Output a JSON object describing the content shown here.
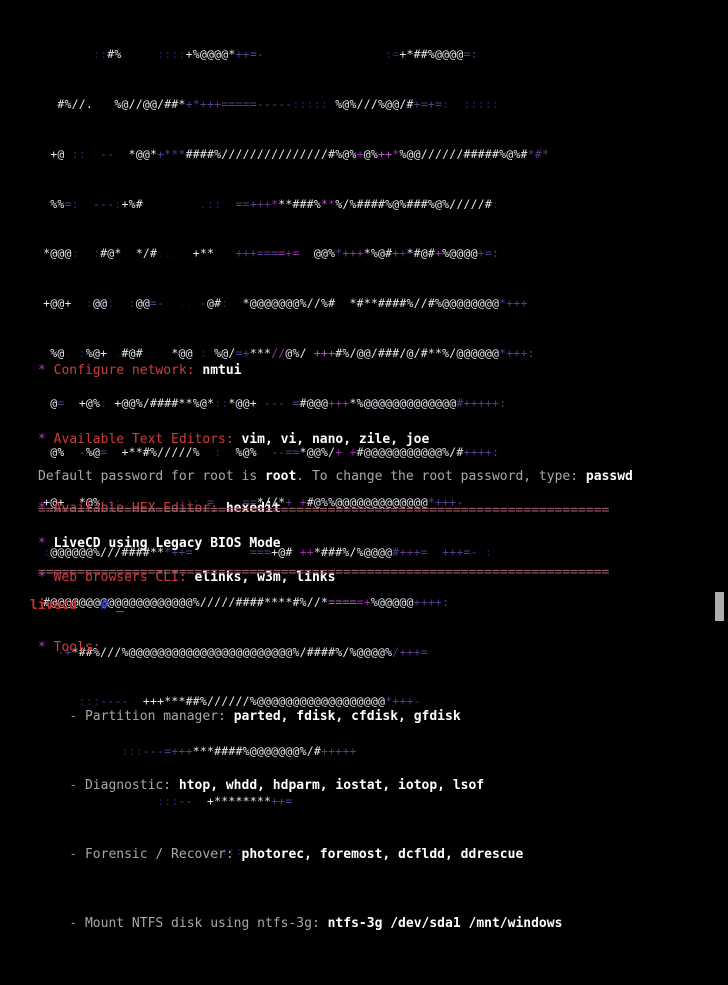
{
  "terminal": {
    "background_color": "#000000",
    "ascii_art": {
      "description": "systemrescue-liveCD ascii logo",
      "rows": [
        "      :#%.    :::+%@@@@*++=-                 :=+*##%@@@@=:",
        "   #%//.   %@//@@/##*++++===----:::::  %@%///%@@/#+=+=:  :::::",
        "  +@ ::  --  *@@*+***####%///////////////#%@%+  @%++*%@@//////#####%##*#*",
        "  %%=:  --:+%#        .::  ==+++#**###@#*#*%%/%#####%@%###%@%/////#:",
        " *@@@:  :#@*  */#.....+**   +++===-=+=  @@%*+++*%@#++*#@#+%@@@@+=:",
        " +@@+  :@@:  :@=-  .. -@#:  *@@@@@@@%//%#  *#**####%//#%@@@@@@@@*+++",
        "  %@. :%@+ .#@#    *@@ : %@/=+***//@%/ +++#%/@@/###/@/#**%/@@@@@@*+++:",
        "  @=  +@%: +@@%/####**%@*::*@@+ --- =#@@@+++*%@@@@@@@@@@@@@#+++++:",
        "  @%  -%@= +**#%/////%  :  %@%  --==*@@%/+ +#@@@@@@@@@@@%/#++++:",
        " +@+  *@%:::       .::: =    ==*//*+ +#@%%@@@@@@@@@@@@@*+++-",
        " :@@@@@@%///####***++=        ===+@# ++*###%/%@@@@#+++=  +++=- :",
        " #@@@@@@@@@@@@@@@@@@@@%/////####****#%//*====+%@@@@@++++:",
        "   -+*##%///%@@@@@@@@@@@@@@@@@@@@@@@%/####%/%@@@@/+++=",
        "      :::----  +++***##%//////%@@@@@@@@@@@@@@@@@@*+++-",
        "            :::---=+++***####%@@@@@@@%/#+++++",
        "                 :::--  +********++="
      ]
    },
    "info_lines": [
      {
        "bullet": "*",
        "label": "Configure network",
        "sep": ": ",
        "value": "nmtui"
      },
      {
        "bullet": "*",
        "label": "Available Text Editors",
        "sep": ": ",
        "value": "vim, vi, nano, zile, joe"
      },
      {
        "bullet": "*",
        "label": "Available HEX Editor",
        "sep": ": ",
        "value": "hexedit"
      },
      {
        "bullet": "*",
        "label": "Web browsers CLI",
        "sep": ": ",
        "value": "elinks, w3m, links"
      },
      {
        "bullet": "*",
        "label": "Tools",
        "sep": ":",
        "value": ""
      }
    ],
    "tool_lines": [
      {
        "dash": "-",
        "sublabel": "Partition manager: ",
        "value": "parted, fdisk, cfdisk, gfdisk"
      },
      {
        "dash": "-",
        "sublabel": "Diagnostic: ",
        "value": "htop, whdd, hdparm, iostat, iotop, lsof"
      },
      {
        "dash": "-",
        "sublabel": "Forensic / Recover: ",
        "value": "photorec, foremost, dcfldd, ddrescue"
      },
      {
        "dash": "-",
        "sublabel": "Mount NTFS disk using ntfs-3g: ",
        "value": "ntfs-3g /dev/sda1 /mnt/windows"
      }
    ],
    "password_note": {
      "prefix": "Default password for root is ",
      "password": "root",
      "middle": ". To change the root password, type: ",
      "command": "passwd"
    },
    "separator": "=========================================================================",
    "bios_line": {
      "bullet": "*",
      "text": "LiveCD using Legacy BIOS Mode"
    },
    "prompt": {
      "host": "livecd",
      "path": "~",
      "symbol": "#",
      "cursor": "_"
    },
    "colors": {
      "bullet": "#c030c8",
      "label": "#d03c3c",
      "value": "#ffffff",
      "sublabel": "#a8a8a8",
      "separator": "#9b5f6b",
      "prompt_host": "#cc2f2f",
      "prompt_symbol": "#3333cc",
      "scrollbar_thumb": "#aeaeae"
    }
  }
}
